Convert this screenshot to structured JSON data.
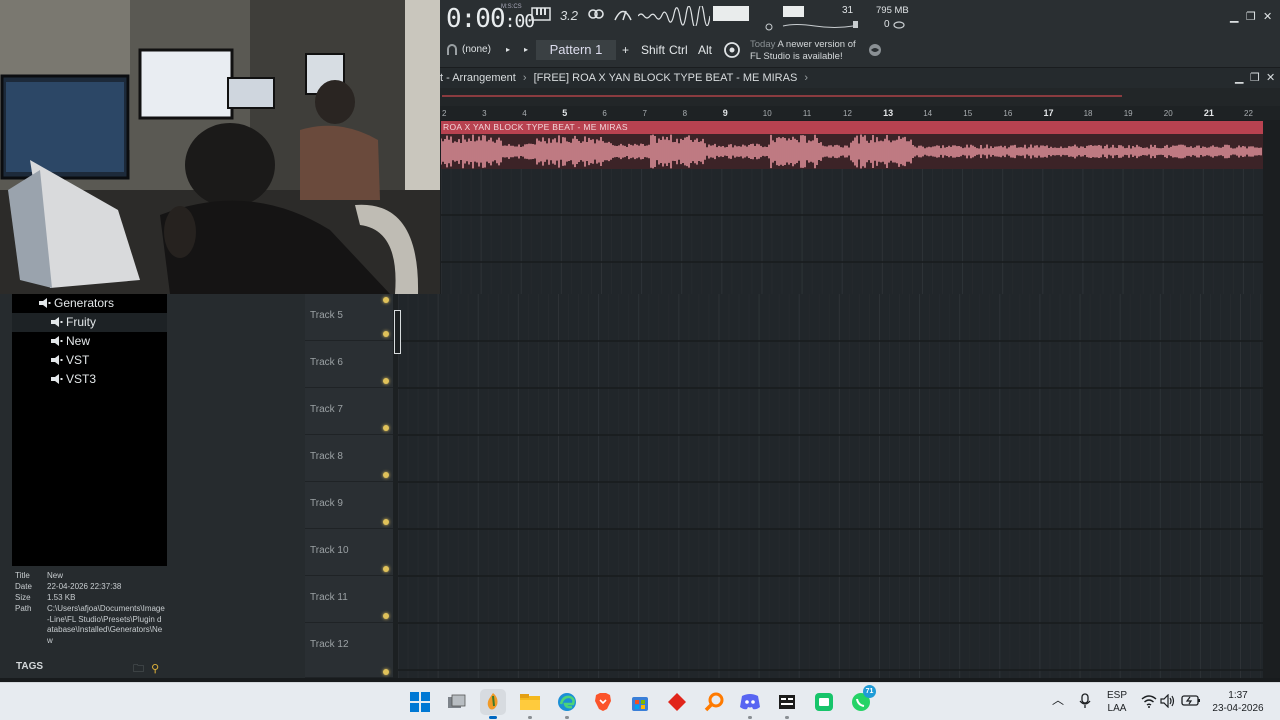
{
  "toolbar": {
    "time": "0:00",
    "time_small": ":00",
    "time_label": "M:S:CS",
    "bpm_icon_text": "3.2",
    "cpu_value": "31",
    "memory": "795 MB",
    "polyphony": "0",
    "snap": "(none)",
    "pattern": "Pattern 1",
    "add_symbol": "+",
    "modifiers": [
      "Shift",
      "Ctrl",
      "Alt"
    ],
    "news_date": "Today",
    "news_text_1": "A newer version of",
    "news_text_2": "FL Studio is available!"
  },
  "arrangement": {
    "breadcrumb_1": "t - Arrangement",
    "breadcrumb_sep": "›",
    "breadcrumb_2": "[FREE] ROA X YAN BLOCK TYPE BEAT - ME MIRAS",
    "breadcrumb_end": "›",
    "ruler": [
      "2",
      "3",
      "4",
      "5",
      "6",
      "7",
      "8",
      "9",
      "10",
      "11",
      "12",
      "13",
      "14",
      "15",
      "16",
      "17",
      "18",
      "19",
      "20",
      "21",
      "22"
    ],
    "clip_title": "ROA X YAN BLOCK TYPE BEAT - ME MIRAS"
  },
  "tracks": [
    "Track 5",
    "Track 6",
    "Track 7",
    "Track 8",
    "Track 9",
    "Track 10",
    "Track 11",
    "Track 12"
  ],
  "browser": {
    "root": "Generators",
    "items": [
      "Fruity",
      "New",
      "VST",
      "VST3"
    ],
    "info": {
      "title_key": "Title",
      "title": "New",
      "date_key": "Date",
      "date": "22-04-2026 22:37:38",
      "size_key": "Size",
      "size": "1.53 KB",
      "path_key": "Path",
      "path": "C:\\Users\\afjoa\\Documents\\Image-Line\\FL Studio\\Presets\\Plugin database\\Installed\\Generators\\New"
    },
    "tags_label": "TAGS"
  },
  "taskbar": {
    "apps": [
      "start-icon",
      "task-view-icon",
      "fl-studio-icon",
      "file-explorer-icon",
      "edge-icon",
      "brave-icon",
      "store-icon",
      "red-app-icon",
      "search-app-icon",
      "discord-icon",
      "obs-icon",
      "green-app-icon",
      "whatsapp-icon"
    ],
    "whatsapp_badge": "71",
    "lang_1": "ESP",
    "lang_2": "LAA",
    "clock_time": "1:37",
    "clock_date": "23-04-2026"
  },
  "colors": {
    "clip_header": "#b84250",
    "waveform": "#e0909a",
    "track_led": "#e0c25a",
    "taskbar": "#e7ebf0"
  }
}
